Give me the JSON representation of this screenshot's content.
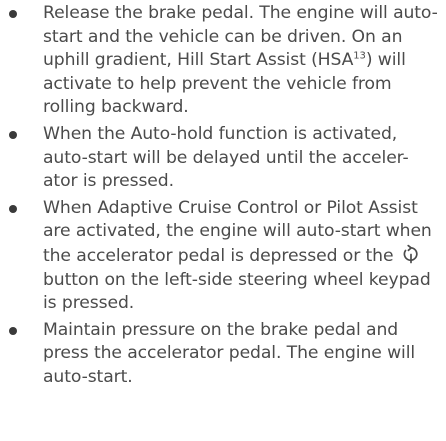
{
  "bullets": [
    {
      "text_a": "Release the brake pedal. The engine will auto-start and the vehicle can be driven. On an uphill gradient, Hill Start Assist (HSA",
      "superscript": "13",
      "text_b": ") will activate to help prevent the vehicle from rolling backward."
    },
    {
      "text": "When the Auto-hold function is activated, auto-start will be delayed until the acceler-ator is pressed."
    },
    {
      "text_a": "When Adaptive Cruise Control or Pilot Assist are activated, the engine will auto-start when the accelerator pedal is depressed or the",
      "icon": "resume-cruise-icon",
      "text_b": "button on the left-side steering wheel keypad is pressed."
    },
    {
      "text": "Maintain pressure on the brake pedal and press the accelerator pedal. The engine will auto-start."
    }
  ]
}
